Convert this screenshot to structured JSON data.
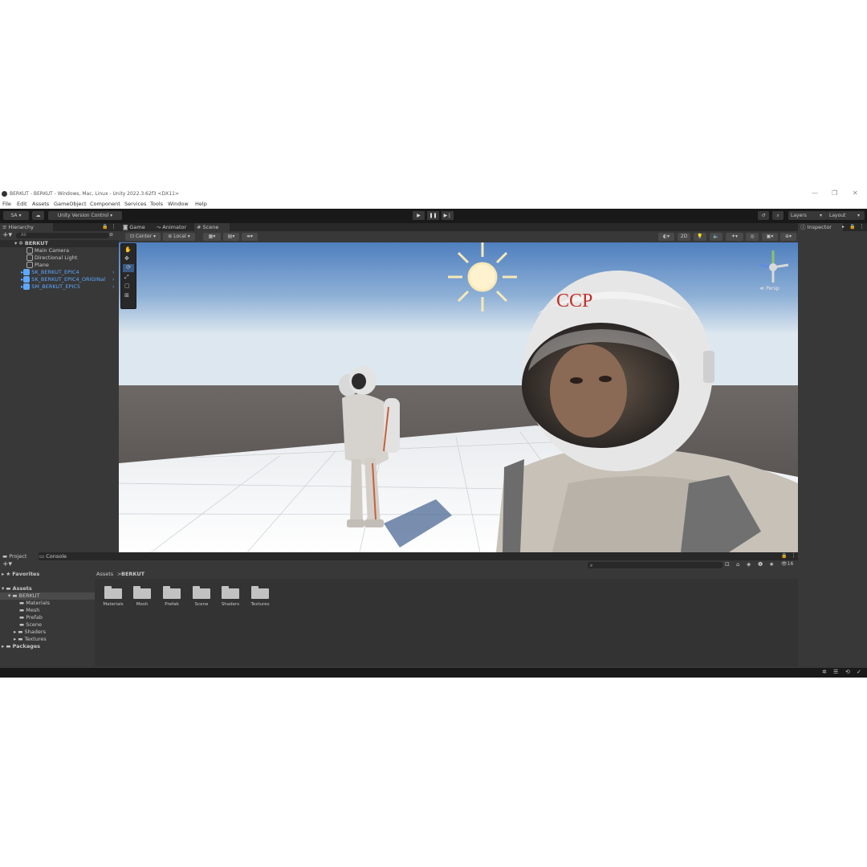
{
  "window": {
    "title": "BERKUT - BERKUT - Windows, Mac, Linux - Unity 2022.3.62f3 <DX11>",
    "minimize": "—",
    "maximize": "❐",
    "close": "✕"
  },
  "menu": [
    "File",
    "Edit",
    "Assets",
    "GameObject",
    "Component",
    "Services",
    "Tools",
    "Window",
    "Help"
  ],
  "toolbar": {
    "account": "SA ▾",
    "version_control": "Unity Version Control ▾",
    "layers": "Layers",
    "layout": "Layout"
  },
  "hierarchy": {
    "tab": "Hierarchy",
    "search_placeholder": "All",
    "scene": "BERKUT",
    "items": [
      {
        "label": "Main Camera"
      },
      {
        "label": "Directional Light"
      },
      {
        "label": "Plane"
      },
      {
        "label": "SK_BERKUT_EPIC4"
      },
      {
        "label": "SK_BERKUT_EPIC4_ORIGINal"
      },
      {
        "label": "SM_BERKUT_EPIC5"
      }
    ]
  },
  "scene_view": {
    "tabs": [
      "Game",
      "Animator",
      "Scene"
    ],
    "pivot": "Center",
    "space": "Local",
    "mode_2d": "2D",
    "persp": "≪ Persp",
    "helmet_text": "CCP"
  },
  "inspector": {
    "tab": "Inspector"
  },
  "project": {
    "tabs": [
      "Project",
      "Console"
    ],
    "favorites": "Favorites",
    "assets": "Assets",
    "berkut": "BERKUT",
    "tree": [
      "Materials",
      "Mesh",
      "Prefab",
      "Scene",
      "Shaders",
      "Textures"
    ],
    "packages": "Packages",
    "breadcrumb_root": "Assets",
    "breadcrumb_sep": ">",
    "breadcrumb_current": "BERKUT",
    "folders": [
      "Materials",
      "Mesh",
      "Prefab",
      "Scene",
      "Shaders",
      "Textures"
    ],
    "count": "16"
  },
  "colors": {
    "editor_bg": "#282828",
    "panel": "#383838",
    "toolbar": "#191919",
    "selection": "#3a5a84",
    "link_blue": "#5fa8ff"
  }
}
